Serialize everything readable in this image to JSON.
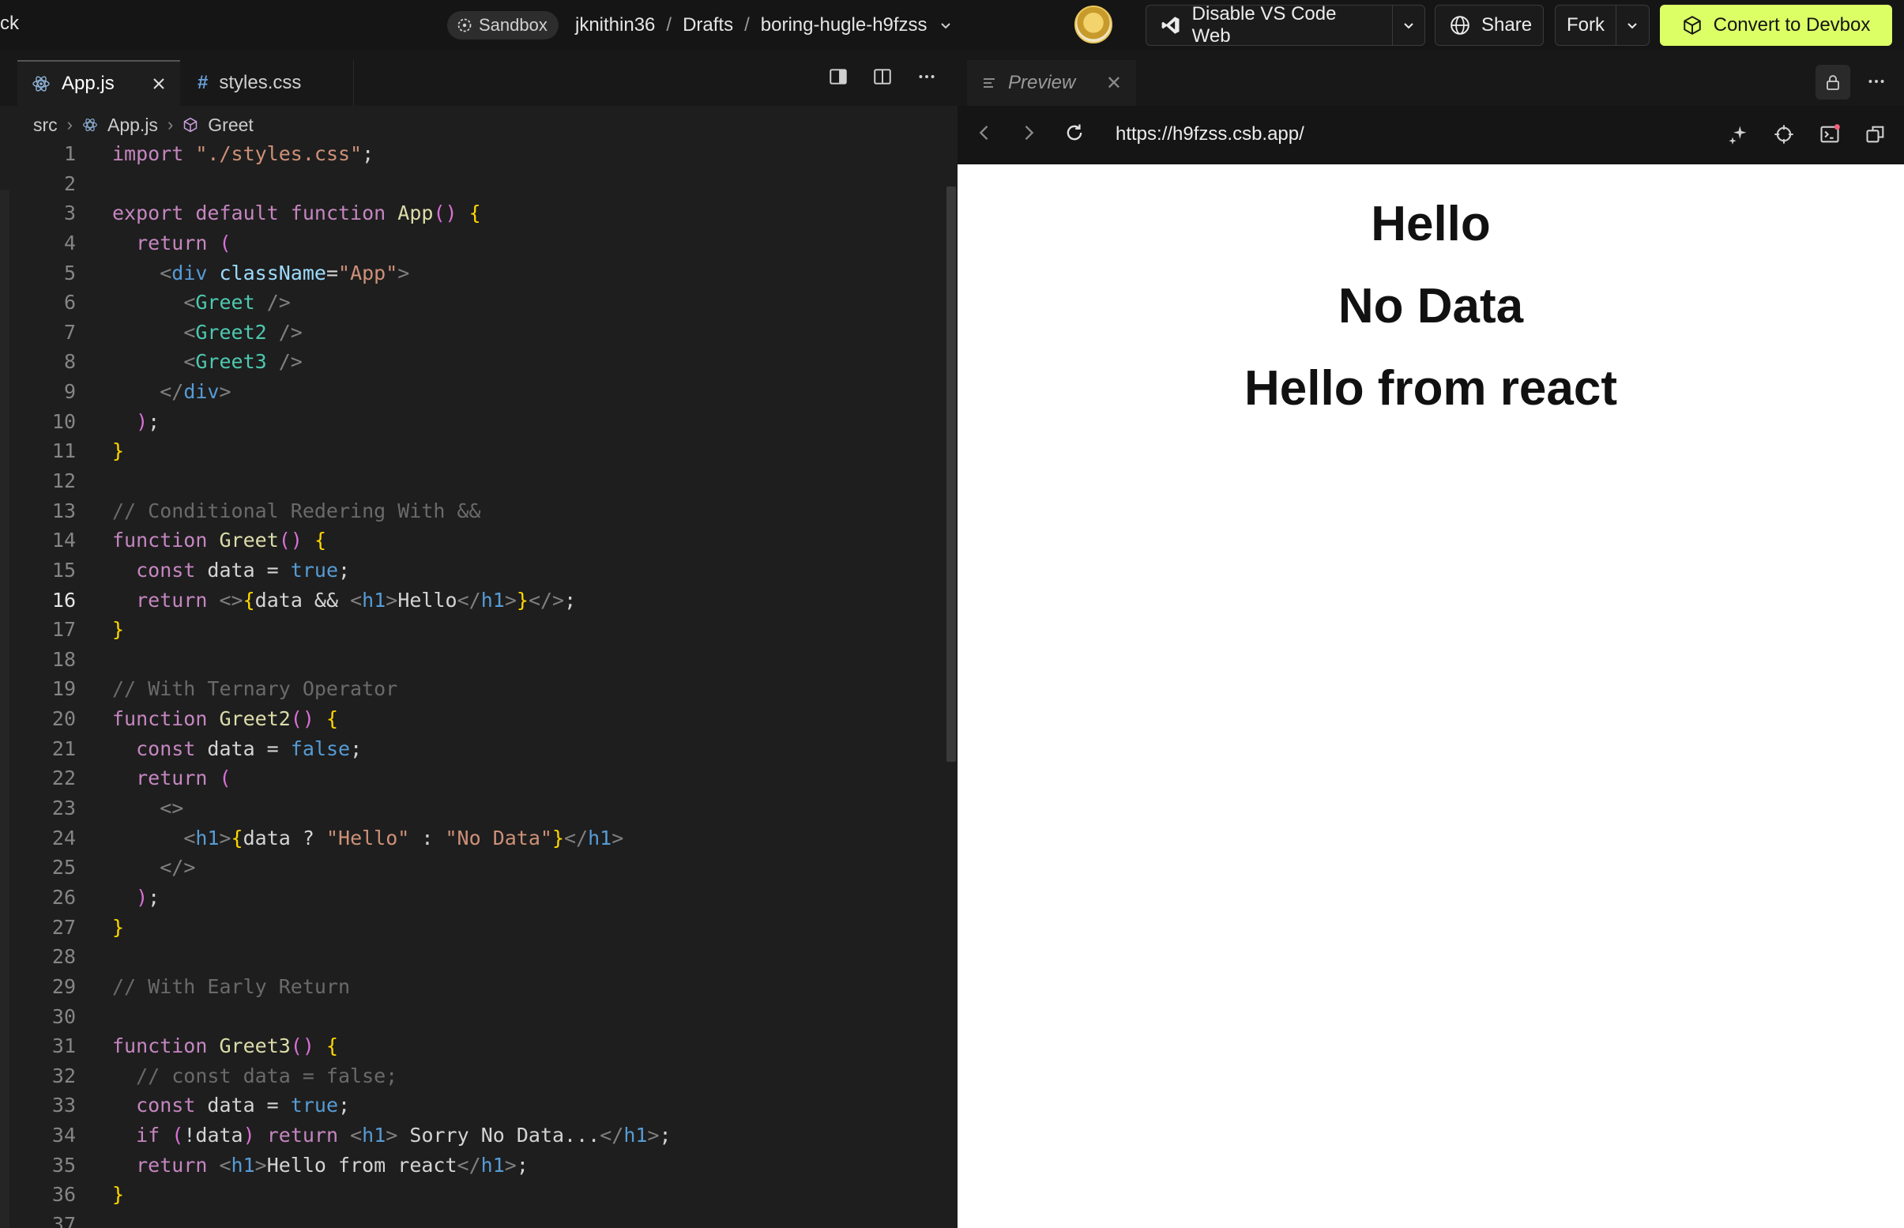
{
  "topbar": {
    "left_fragment": "ck",
    "sandbox_label": "Sandbox",
    "path": {
      "user": "jknithin36",
      "folder": "Drafts",
      "project": "boring-hugle-h9fzss",
      "sep": "/"
    },
    "disable_vscode_label": "Disable VS Code Web",
    "share_label": "Share",
    "fork_label": "Fork",
    "convert_label": "Convert to Devbox"
  },
  "editor": {
    "tabs": [
      {
        "label": "App.js",
        "icon": "react-icon"
      },
      {
        "label": "styles.css",
        "icon": "hash-icon"
      }
    ],
    "breadcrumbs": [
      "src",
      "App.js",
      "Greet"
    ],
    "current_line": 16,
    "line_numbers": [
      "1",
      "2",
      "3",
      "4",
      "5",
      "6",
      "7",
      "8",
      "9",
      "10",
      "11",
      "12",
      "13",
      "14",
      "15",
      "16",
      "17",
      "18",
      "19",
      "20",
      "21",
      "22",
      "23",
      "24",
      "25",
      "26",
      "27",
      "28",
      "29",
      "30",
      "31",
      "32",
      "33",
      "34",
      "35",
      "36",
      "37"
    ],
    "lines": [
      "import \"./styles.css\";",
      "",
      "export default function App() {",
      "  return (",
      "    <div className=\"App\">",
      "      <Greet />",
      "      <Greet2 />",
      "      <Greet3 />",
      "    </div>",
      "  );",
      "}",
      "",
      "// Conditional Redering With &&",
      "function Greet() {",
      "  const data = true;",
      "  return <>{data && <h1>Hello</h1>}</>;",
      "}",
      "",
      "// With Ternary Operator",
      "function Greet2() {",
      "  const data = false;",
      "  return (",
      "    <>",
      "      <h1>{data ? \"Hello\" : \"No Data\"}</h1>",
      "    </>",
      "  );",
      "}",
      "",
      "// With Early Return",
      "",
      "function Greet3() {",
      "  // const data = false;",
      "  const data = true;",
      "  if (!data) return <h1> Sorry No Data...</h1>;",
      "  return <h1>Hello from react</h1>;",
      "}",
      ""
    ]
  },
  "preview": {
    "tab_label": "Preview",
    "url": "https://h9fzss.csb.app/",
    "headings": [
      "Hello",
      "No Data",
      "Hello from react"
    ]
  },
  "colors": {
    "accent_button": "#dcff66",
    "editor_bg": "#1e1e1e",
    "chrome_bg": "#151515"
  }
}
